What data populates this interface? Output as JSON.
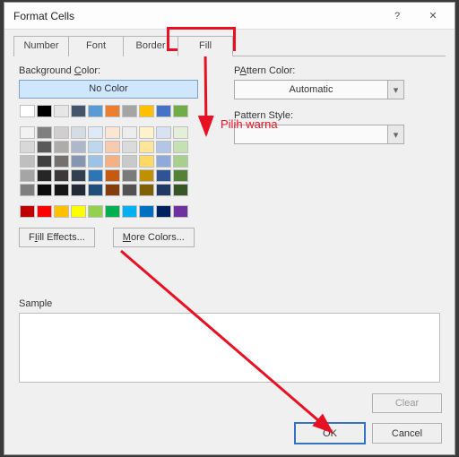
{
  "dialog": {
    "title": "Format Cells",
    "help_icon": "?",
    "close_icon": "✕"
  },
  "tabs": {
    "number": "Number",
    "font": "Font",
    "border": "Border",
    "fill": "Fill"
  },
  "left": {
    "bg_label_pre": "Background ",
    "bg_label_u": "C",
    "bg_label_post": "olor:",
    "no_color": "No Color",
    "fill_effects_u": "I",
    "fill_effects_post": "ill Effects...",
    "fill_effects_pre": "F",
    "more_colors_u": "M",
    "more_colors_post": "ore Colors..."
  },
  "right": {
    "pattern_color_u": "A",
    "pattern_color_pre": "P",
    "pattern_color_post": "ttern Color:",
    "automatic": "Automatic",
    "pattern_style_u": "P",
    "pattern_style_pre": "Pattern Style:",
    "pattern_style_label": "Pattern Style:"
  },
  "sample_label": "Sample",
  "buttons": {
    "clear": "Clear",
    "ok": "OK",
    "cancel": "Cancel"
  },
  "annot": {
    "pilih": "Pilih warna"
  },
  "palette": {
    "row1": [
      "#ffffff",
      "#000000",
      "#e7e6e6",
      "#44546a",
      "#5b9bd5",
      "#ed7d31",
      "#a5a5a5",
      "#ffc000",
      "#4472c4",
      "#70ad47"
    ],
    "theme": [
      [
        "#f2f2f2",
        "#7f7f7f",
        "#d0cece",
        "#d6dce4",
        "#deebf6",
        "#fbe5d5",
        "#ededed",
        "#fff2cc",
        "#d9e2f3",
        "#e2efd9"
      ],
      [
        "#d8d8d8",
        "#595959",
        "#aeabab",
        "#adb9ca",
        "#bdd7ee",
        "#f7cbac",
        "#dbdbdb",
        "#fee599",
        "#b4c6e7",
        "#c5e0b3"
      ],
      [
        "#bfbfbf",
        "#3f3f3f",
        "#757070",
        "#8496b0",
        "#9cc3e5",
        "#f4b183",
        "#c9c9c9",
        "#ffd965",
        "#8eaadb",
        "#a8d08d"
      ],
      [
        "#a5a5a5",
        "#262626",
        "#3a3838",
        "#323f4f",
        "#2e75b5",
        "#c55a11",
        "#7b7b7b",
        "#bf9000",
        "#2f5496",
        "#538135"
      ],
      [
        "#7f7f7f",
        "#0c0c0c",
        "#171616",
        "#222a35",
        "#1e4e79",
        "#833c0b",
        "#525252",
        "#7f6000",
        "#1f3864",
        "#375623"
      ]
    ],
    "std": [
      "#c00000",
      "#ff0000",
      "#ffc000",
      "#ffff00",
      "#92d050",
      "#00b050",
      "#00b0f0",
      "#0070c0",
      "#002060",
      "#7030a0"
    ]
  }
}
